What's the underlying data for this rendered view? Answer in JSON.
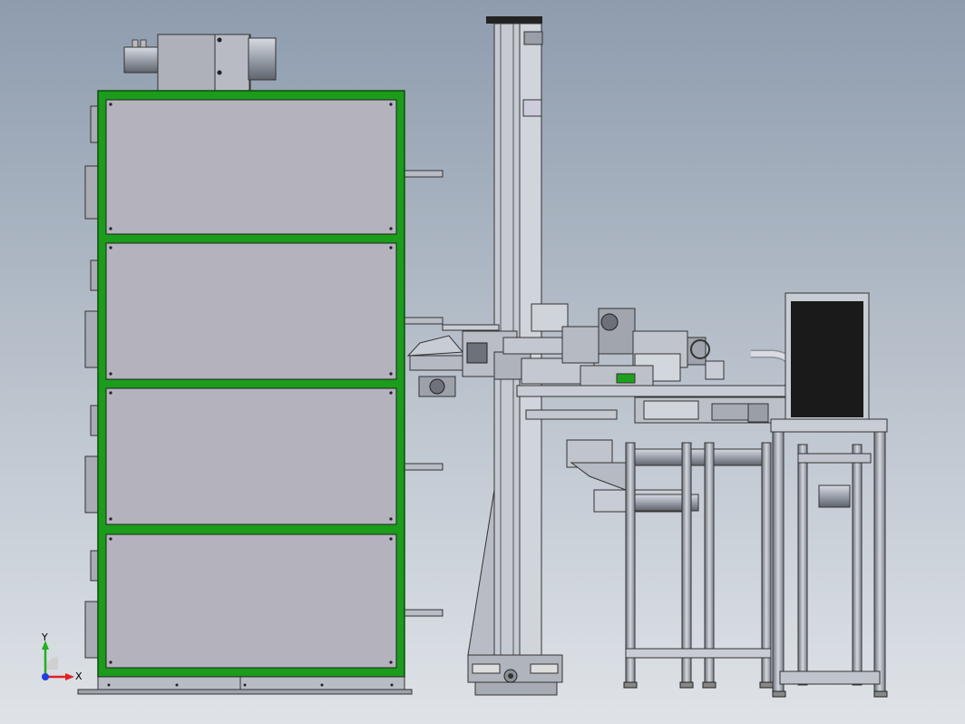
{
  "triad": {
    "x_label": "X",
    "y_label": "Y",
    "x_color": "#e02020",
    "y_color": "#20b020",
    "z_color": "#2040e0"
  },
  "colors": {
    "frame_green": "#1b9c1b",
    "panel_fill": "#b3b2bd",
    "steel": "#c8ccd4",
    "dark_panel": "#1a1a1a"
  },
  "icons": {
    "view_triad": "axes-triad-icon"
  }
}
